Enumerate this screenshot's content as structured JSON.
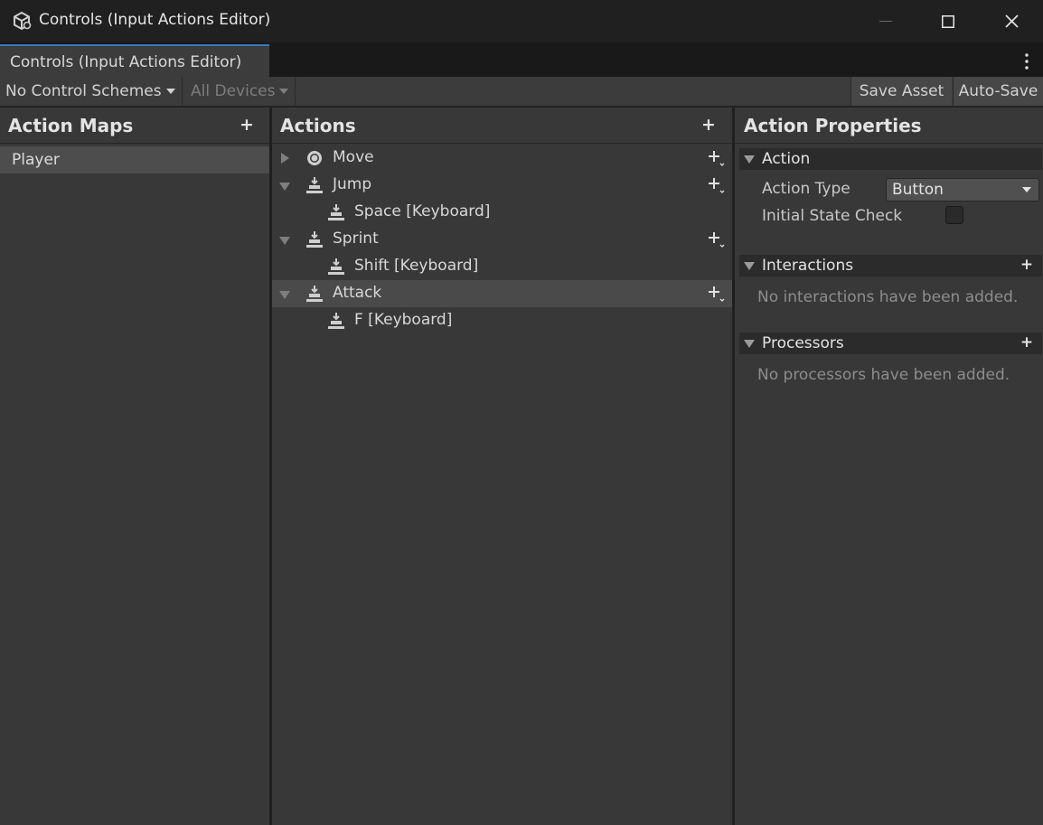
{
  "window": {
    "title": "Controls (Input Actions Editor)"
  },
  "tab": {
    "label": "Controls (Input Actions Editor)"
  },
  "toolbar": {
    "control_schemes": "No Control Schemes",
    "devices": "All Devices",
    "save_label": "Save Asset",
    "auto_save_label": "Auto-Save"
  },
  "action_maps": {
    "title": "Action Maps",
    "items": [
      {
        "label": "Player",
        "selected": true
      }
    ]
  },
  "actions": {
    "title": "Actions",
    "items": [
      {
        "label": "Move",
        "icon": "gamepad-stick-icon",
        "expanded": false,
        "bindings": []
      },
      {
        "label": "Jump",
        "icon": "button-icon",
        "expanded": true,
        "bindings": [
          "Space [Keyboard]"
        ]
      },
      {
        "label": "Sprint",
        "icon": "button-icon",
        "expanded": true,
        "bindings": [
          "Shift [Keyboard]"
        ]
      },
      {
        "label": "Attack",
        "icon": "button-icon",
        "expanded": true,
        "selected": true,
        "bindings": [
          "F [Keyboard]"
        ]
      }
    ]
  },
  "properties": {
    "title": "Action Properties",
    "action_section": {
      "title": "Action",
      "action_type_label": "Action Type",
      "action_type_value": "Button",
      "initial_state_label": "Initial State Check",
      "initial_state_checked": false
    },
    "interactions": {
      "title": "Interactions",
      "empty": "No interactions have been added."
    },
    "processors": {
      "title": "Processors",
      "empty": "No processors have been added."
    }
  },
  "colors": {
    "accent": "#3a79bb",
    "background": "#383838",
    "selected_row": "#4a4a4a"
  }
}
